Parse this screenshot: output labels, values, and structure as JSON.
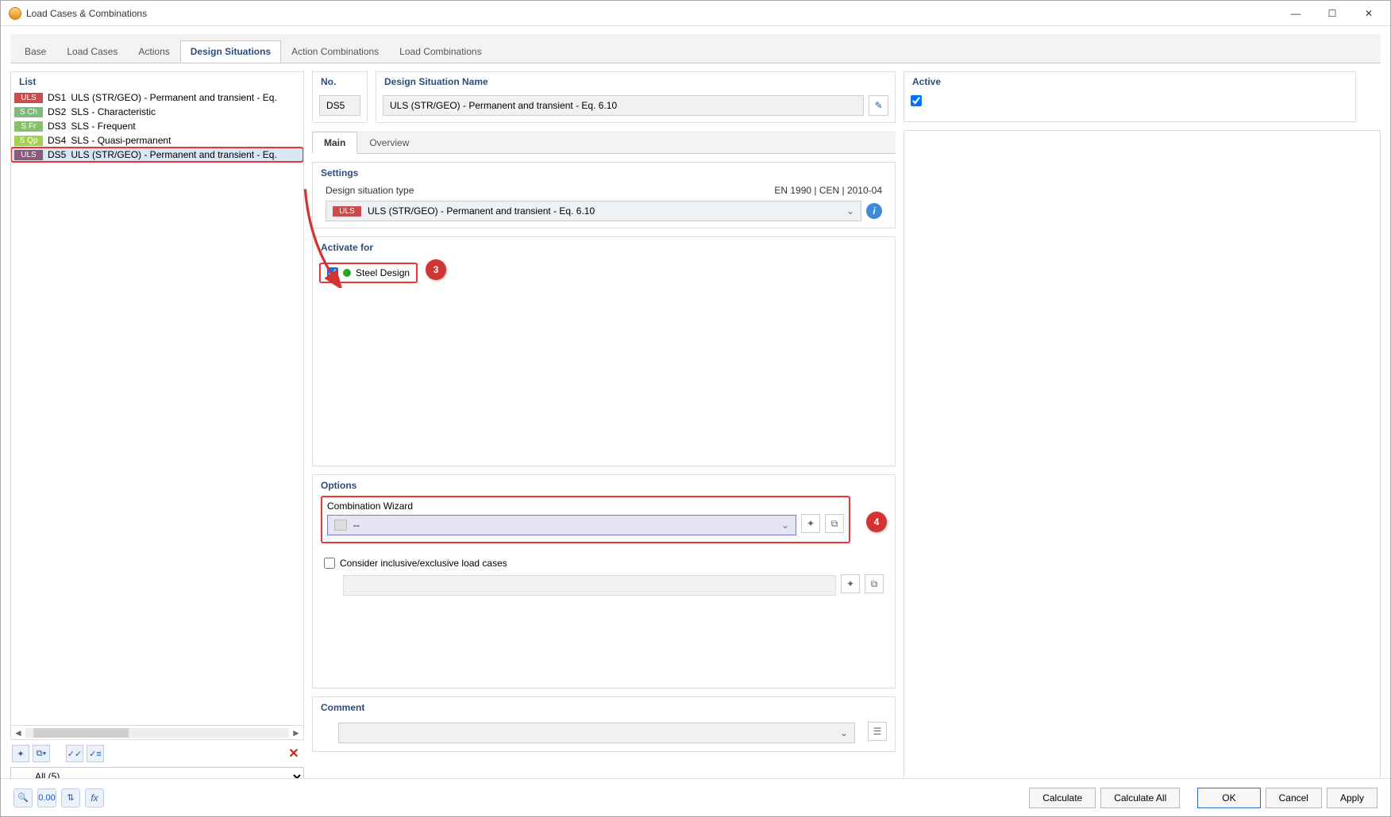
{
  "window": {
    "title": "Load Cases & Combinations"
  },
  "tabs": [
    "Base",
    "Load Cases",
    "Actions",
    "Design Situations",
    "Action Combinations",
    "Load Combinations"
  ],
  "activeTab": "Design Situations",
  "list": {
    "header": "List",
    "items": [
      {
        "badgeClass": "b-uls",
        "badge": "ULS",
        "id": "DS1",
        "name": "ULS (STR/GEO) - Permanent and transient - Eq."
      },
      {
        "badgeClass": "b-sch",
        "badge": "S Ch",
        "id": "DS2",
        "name": "SLS - Characteristic"
      },
      {
        "badgeClass": "b-sfr",
        "badge": "S Fr",
        "id": "DS3",
        "name": "SLS - Frequent"
      },
      {
        "badgeClass": "b-sqp",
        "badge": "S Qp",
        "id": "DS4",
        "name": "SLS - Quasi-permanent"
      },
      {
        "badgeClass": "b-uls-sel",
        "badge": "ULS",
        "id": "DS5",
        "name": "ULS (STR/GEO) - Permanent and transient - Eq.",
        "selected": true
      }
    ],
    "filter": "All (5)"
  },
  "detail": {
    "noLabel": "No.",
    "noValue": "DS5",
    "nameLabel": "Design Situation Name",
    "nameValue": "ULS (STR/GEO) - Permanent and transient - Eq. 6.10",
    "activeLabel": "Active",
    "subtabs": [
      "Main",
      "Overview"
    ],
    "settings": {
      "header": "Settings",
      "typeLabel": "Design situation type",
      "standard": "EN 1990 | CEN | 2010-04",
      "badge": "ULS",
      "typeValue": "ULS (STR/GEO) - Permanent and transient - Eq. 6.10"
    },
    "activate": {
      "header": "Activate for",
      "label": "Steel Design"
    },
    "options": {
      "header": "Options",
      "wizardLabel": "Combination Wizard",
      "wizardValue": "--",
      "considerLabel": "Consider inclusive/exclusive load cases"
    },
    "comment": {
      "header": "Comment"
    }
  },
  "annotations": {
    "a3": "3",
    "a4": "4"
  },
  "bottom": {
    "calculate": "Calculate",
    "calculateAll": "Calculate All",
    "ok": "OK",
    "cancel": "Cancel",
    "apply": "Apply"
  }
}
